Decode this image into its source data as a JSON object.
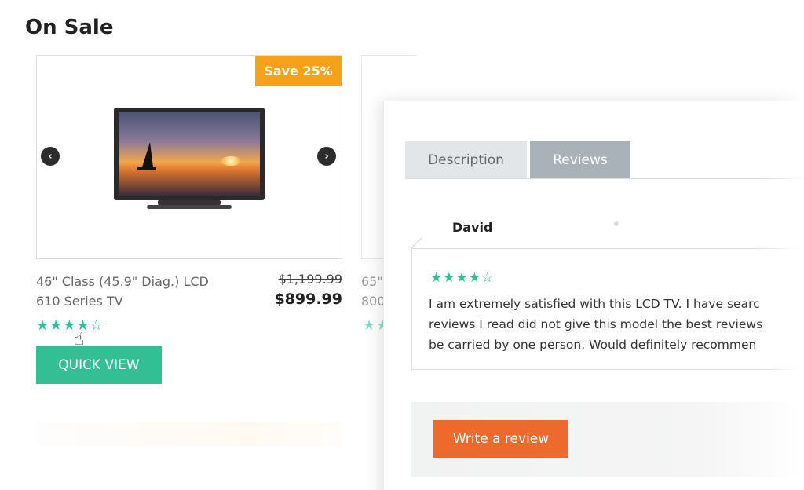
{
  "section": {
    "title": "On Sale"
  },
  "product": {
    "badge": "Save 25%",
    "name_line1": "46\" Class (45.9\" Diag.) LCD",
    "name_line2": "610 Series TV",
    "price_old": "$1,199.99",
    "price_new": "$899.99",
    "rating": 4,
    "rating_max": 5,
    "stars": "★★★★☆",
    "quick_view_label": "QUICK VIEW",
    "prev_icon": "‹",
    "next_icon": "›",
    "cursor_icon": "☝"
  },
  "product2": {
    "name_line1": "65\"",
    "name_line2": "800",
    "stars": "★★"
  },
  "review_panel": {
    "tabs": [
      {
        "label": "Description",
        "active": false
      },
      {
        "label": "Reviews",
        "active": true
      }
    ],
    "review": {
      "author": "David",
      "rating": 4,
      "rating_max": 5,
      "stars": "★★★★☆",
      "lines": [
        "I am extremely satisfied with this LCD TV. I have searc",
        "reviews I read did not give this model the best reviews",
        "be carried by one person. Would definitely recommen"
      ]
    },
    "write_review_label": "Write a review"
  },
  "colors": {
    "accent_green": "#33bf93",
    "badge_orange": "#f7a11a",
    "button_orange": "#ee6a2c",
    "tab_active": "#a9b2b9",
    "tab_inactive": "#e3e6e8"
  }
}
